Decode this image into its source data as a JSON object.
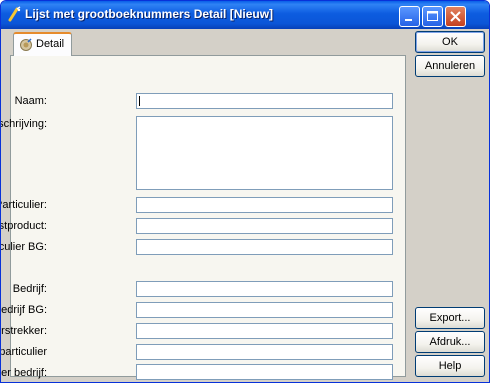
{
  "window": {
    "title": "Lijst met grootboeknummers Detail [Nieuw]",
    "controls": {
      "minimize": "minimize-icon",
      "maximize": "maximize-icon",
      "close": "close-icon"
    }
  },
  "tabs": [
    {
      "label": "Detail",
      "icon": "detail-tab-icon",
      "active": true
    }
  ],
  "form": {
    "naam": {
      "label": "Naam:",
      "value": ""
    },
    "omschrijving": {
      "label": "Omschrijving:",
      "value": ""
    },
    "particulier": {
      "label": "Particulier:",
      "value": ""
    },
    "vastproduct": {
      "label": "Vastproduct:",
      "value": ""
    },
    "particulier_bg": {
      "label": "Particulier BG:",
      "value": ""
    },
    "bedrijf": {
      "label": "Bedrijf:",
      "value": ""
    },
    "bedrijf_bg": {
      "label": "Bedrijf BG:",
      "value": ""
    },
    "subsidieverstrekker": {
      "label": "Subsidieverstrekker:",
      "value": ""
    },
    "gastouder_particulier": {
      "label": "Gastouder particulier",
      "value": ""
    },
    "gastouder_bedrijf": {
      "label": "Gastouder bedrijf:",
      "value": ""
    }
  },
  "buttons": {
    "ok": "OK",
    "annuleren": "Annuleren",
    "export": "Export...",
    "afdruk": "Afdruk...",
    "help": "Help"
  },
  "colors": {
    "titlebar": "#0b56d8",
    "window_frame": "#0831d9",
    "client_bg": "#d4d0c8",
    "panel_bg": "#f7f6f0",
    "field_border": "#7f9db9",
    "tab_highlight": "#e68b2c"
  }
}
